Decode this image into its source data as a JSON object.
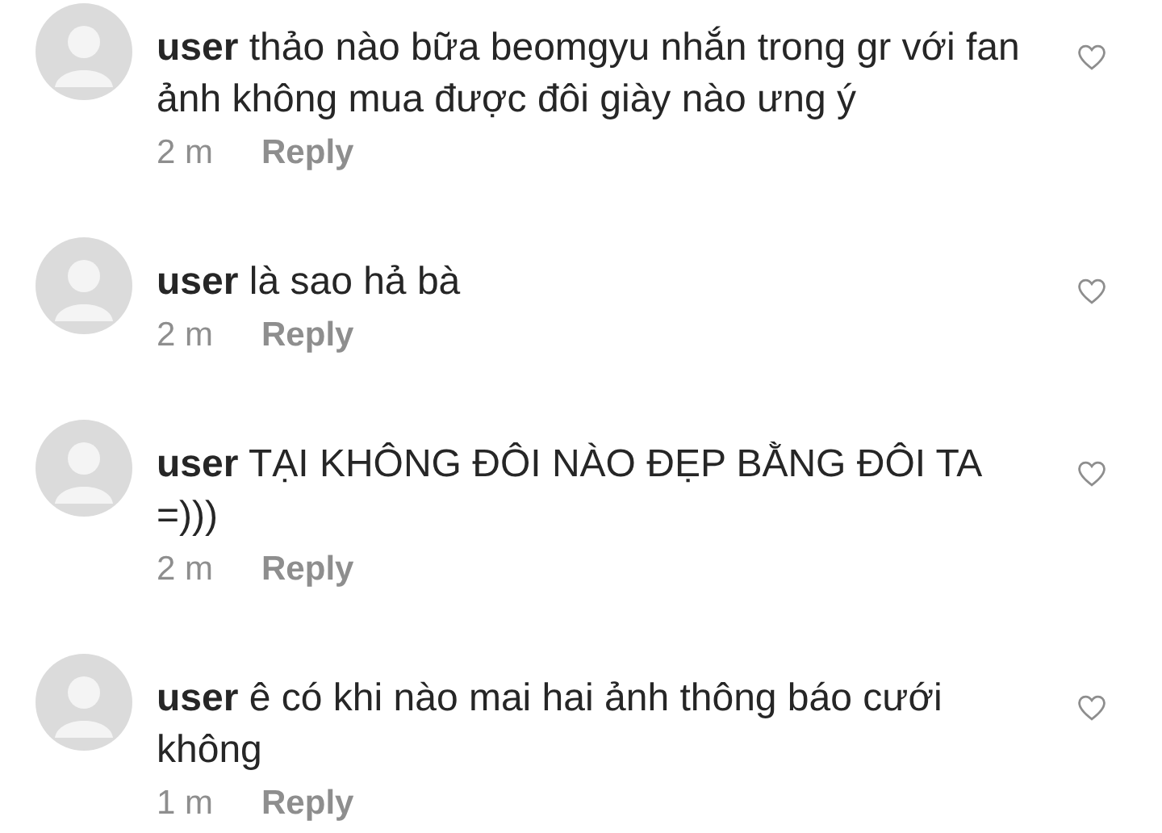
{
  "comments": [
    {
      "text": "**user** thảo nào bữa beomgyu nhắn trong gr với fan ảnh không mua được đôi giày nào ưng ý",
      "time": "2 m",
      "reply": "Reply",
      "liked": false
    },
    {
      "text": "**user** là sao hả bà",
      "time": "2 m",
      "reply": "Reply",
      "liked": false
    },
    {
      "text": "**user** TẠI KHÔNG ĐÔI NÀO ĐẸP BẰNG ĐÔI TA =)))",
      "time": "2 m",
      "reply": "Reply",
      "liked": false
    },
    {
      "text": "**user** ê có khi nào mai hai ảnh thông báo cưới không",
      "time": "1 m",
      "reply": "Reply",
      "liked": false
    }
  ]
}
